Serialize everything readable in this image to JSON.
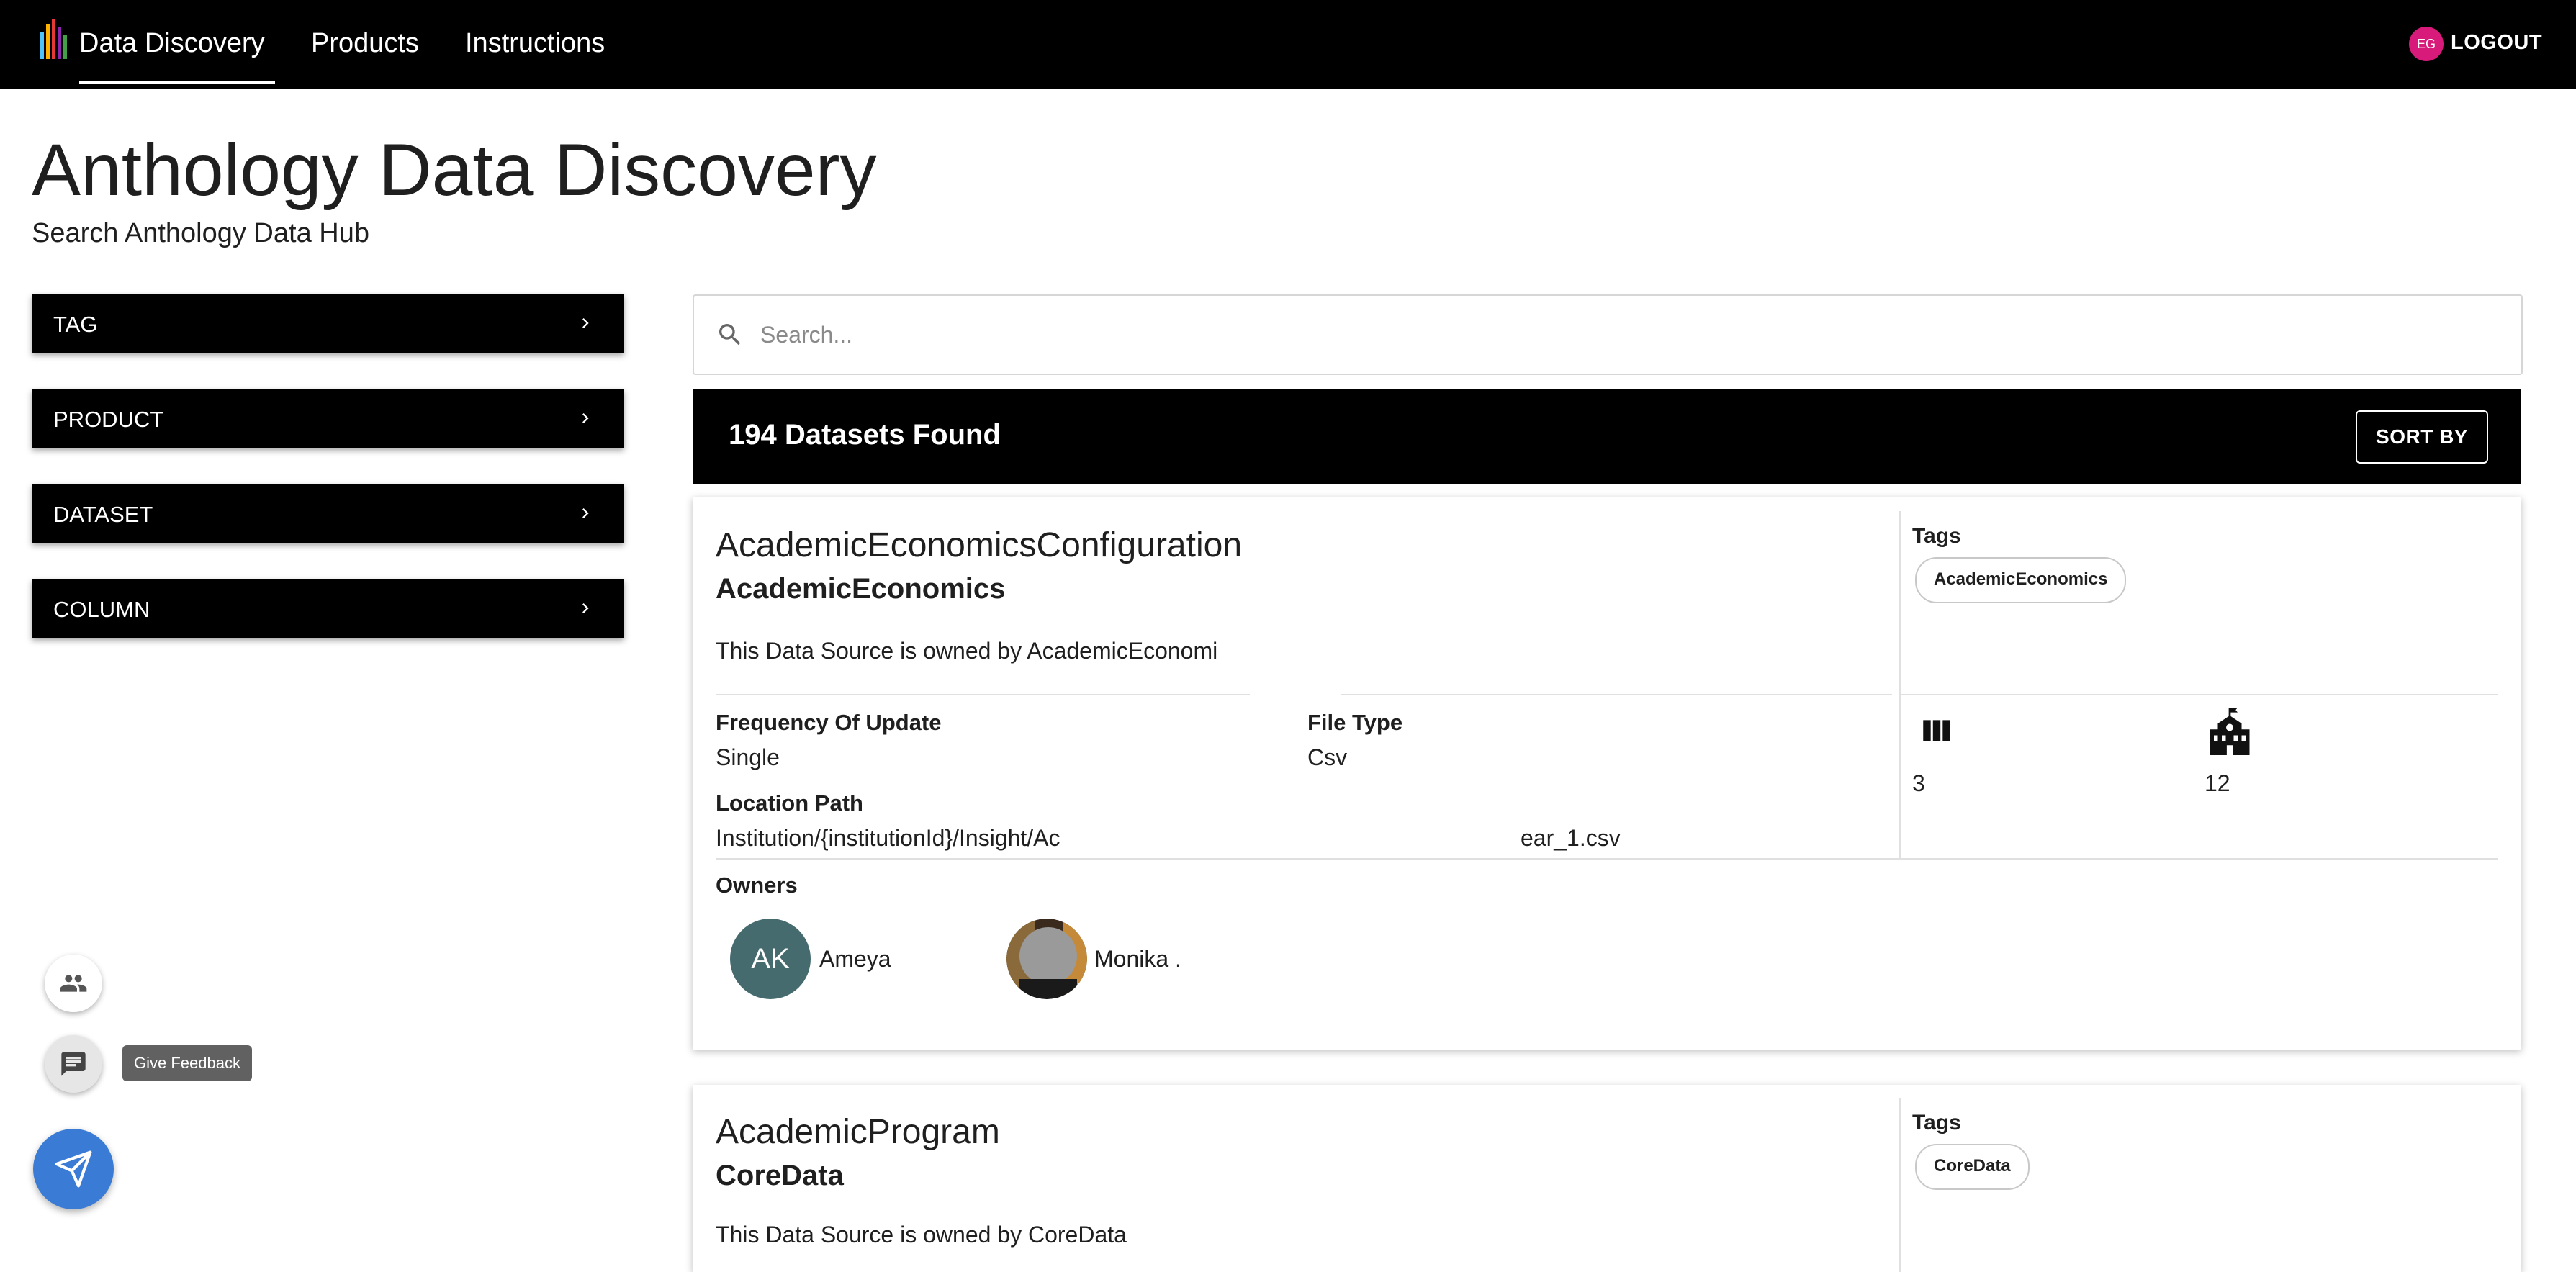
{
  "header": {
    "app_name": "Data Discovery",
    "nav": [
      "Products",
      "Instructions"
    ],
    "user_initials": "EG",
    "logout_label": "LOGOUT"
  },
  "page": {
    "title": "Anthology Data Discovery",
    "subtitle": "Search Anthology Data Hub"
  },
  "filters": [
    "TAG",
    "PRODUCT",
    "DATASET",
    "COLUMN"
  ],
  "search": {
    "placeholder": "Search..."
  },
  "results": {
    "count_label": "194 Datasets Found",
    "sort_label": "SORT BY"
  },
  "datasets": [
    {
      "name": "AcademicEconomicsConfiguration",
      "product": "AcademicEconomics",
      "description": "This Data Source is owned by AcademicEconomi",
      "tags_label": "Tags",
      "tags": [
        "AcademicEconomics"
      ],
      "frequency_label": "Frequency Of Update",
      "frequency": "Single",
      "file_type_label": "File Type",
      "file_type": "Csv",
      "location_label": "Location Path",
      "location_start": "Institution/{institutionId}/Insight/Ac",
      "location_end": "ear_1.csv",
      "columns_count": "3",
      "institutions_count": "12",
      "owners_label": "Owners",
      "owners": [
        {
          "initials": "AK",
          "name": "Ameya"
        },
        {
          "initials": "",
          "name": "Monika ."
        }
      ]
    },
    {
      "name": "AcademicProgram",
      "product": "CoreData",
      "description": "This Data Source is owned by CoreData",
      "tags_label": "Tags",
      "tags": [
        "CoreData"
      ]
    }
  ],
  "feedback": {
    "tooltip": "Give Feedback"
  },
  "colors": {
    "header_bg": "#000000",
    "user_avatar": "#d81b7a",
    "owner_avatar": "#456b6f",
    "send_fab": "#3a7bd5"
  },
  "icons": [
    "people-icon",
    "chat-icon",
    "send-icon",
    "search-icon",
    "chevron-right-icon",
    "columns-icon",
    "institution-icon"
  ]
}
